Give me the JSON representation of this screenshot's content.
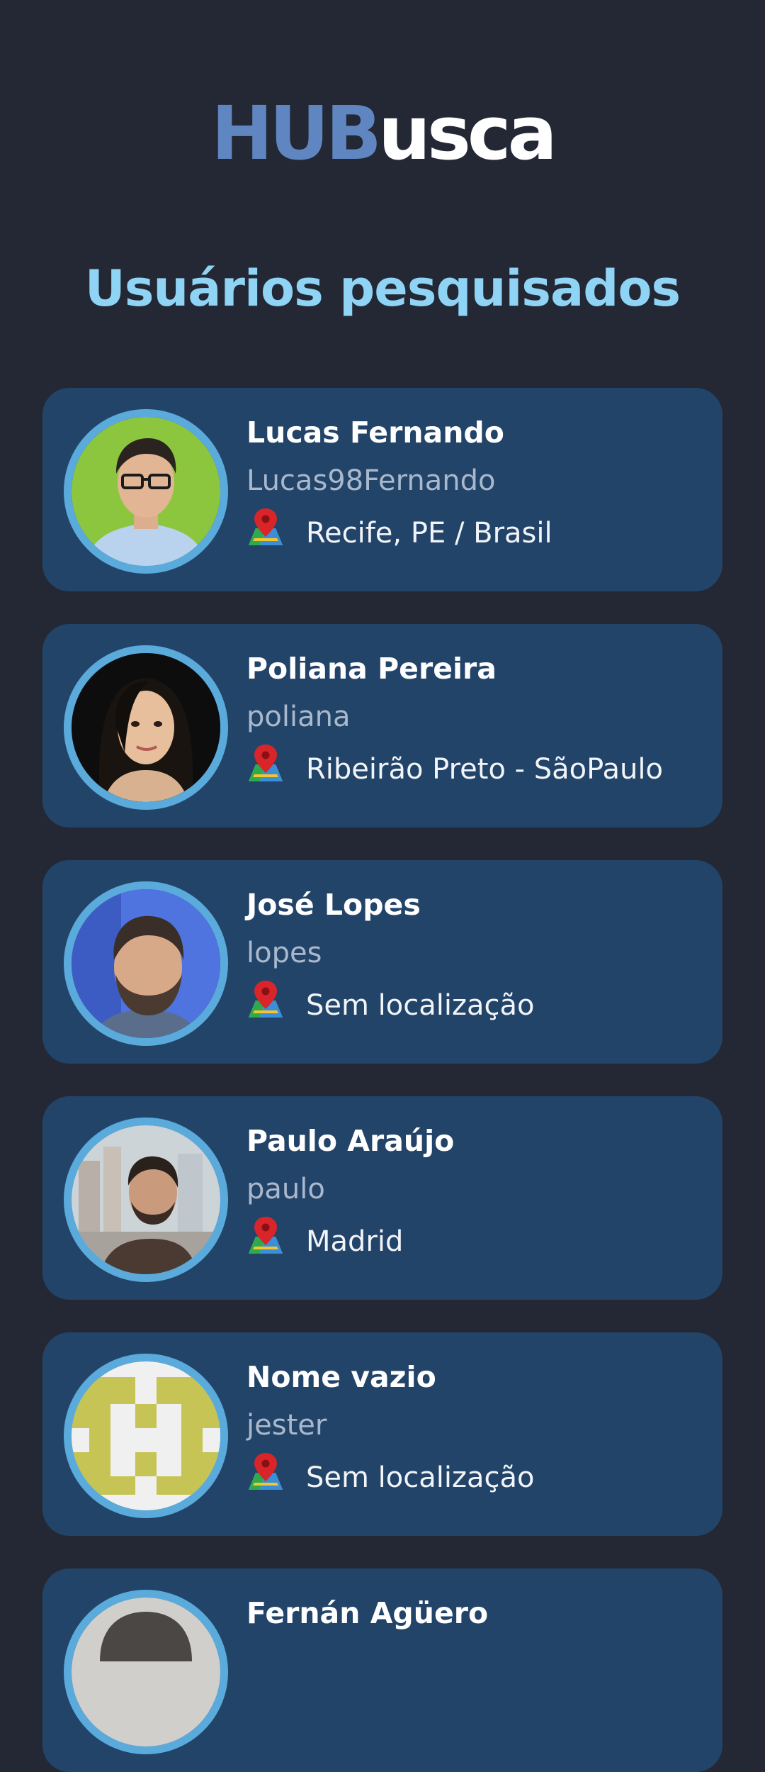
{
  "header": {
    "logo_part1": "HUB",
    "logo_part2": "usca",
    "title": "Usuários pesquisados"
  },
  "colors": {
    "background": "#232834",
    "card": "#234469",
    "avatar_ring": "#5aaadb",
    "title": "#8fd3f5",
    "logo_accent": "#5f86c0"
  },
  "users": [
    {
      "name": "Lucas Fernando",
      "login": "Lucas98Fernando",
      "location": "Recife, PE / Brasil",
      "icon": "map-pin-icon"
    },
    {
      "name": "Poliana Pereira",
      "login": "poliana",
      "location": "Ribeirão Preto - SãoPaulo",
      "icon": "map-pin-icon"
    },
    {
      "name": "José Lopes",
      "login": "lopes",
      "location": "Sem localização",
      "icon": "map-pin-icon"
    },
    {
      "name": "Paulo Araújo",
      "login": "paulo",
      "location": "Madrid",
      "icon": "map-pin-icon"
    },
    {
      "name": "Nome vazio",
      "login": "jester",
      "location": "Sem localização",
      "icon": "map-pin-icon"
    },
    {
      "name": "Fernán Agüero",
      "login": "",
      "location": "",
      "icon": "map-pin-icon"
    }
  ]
}
